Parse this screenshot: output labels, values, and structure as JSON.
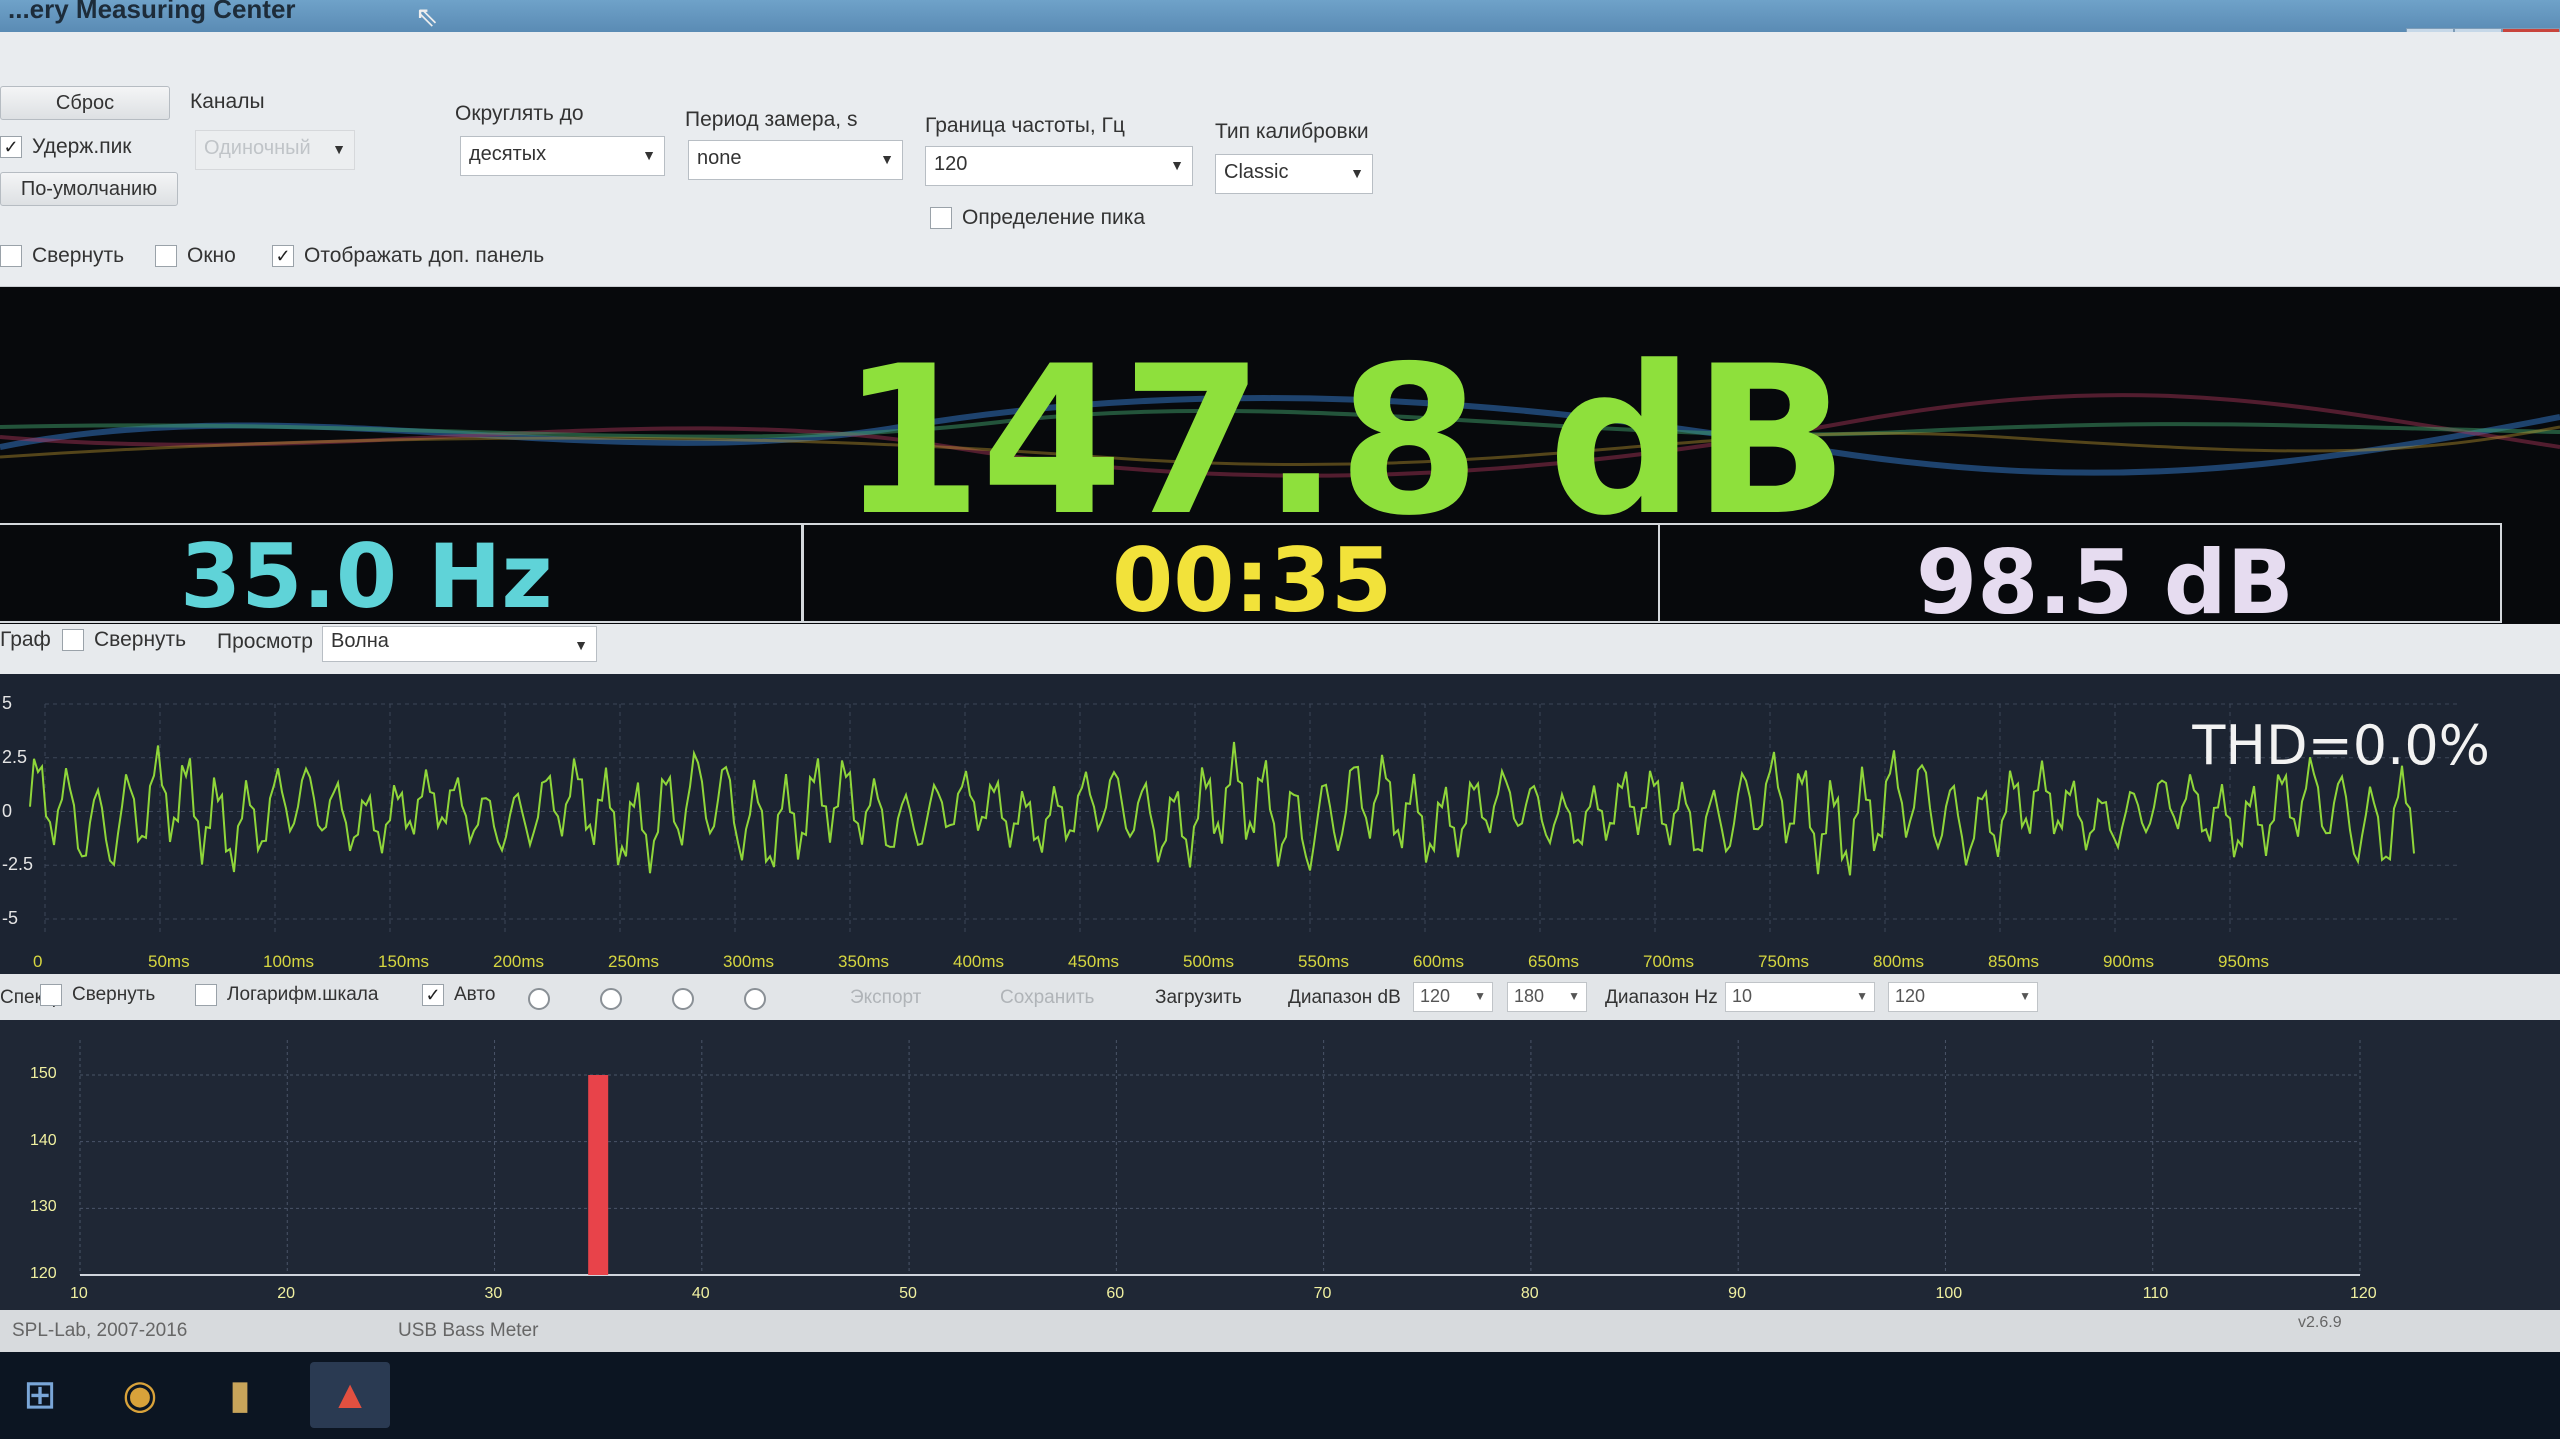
{
  "window": {
    "title": "...ery Measuring Center",
    "minimize": "—",
    "restore": "▫",
    "close": "X"
  },
  "toolbar": {
    "reset_label": "Сброс",
    "channels_label": "Каналы",
    "hold_peak_label": "Удерж.пик",
    "channel_mode_value": "Одиночный",
    "default_label": "По-умолчанию",
    "round_label": "Округлять до",
    "round_value": "десятых",
    "period_label": "Период замера, s",
    "period_value": "none",
    "freq_limit_label": "Граница частоты, Гц",
    "freq_limit_value": "120",
    "calib_label": "Тип калибровки",
    "calib_value": "Classic",
    "peak_detect_label": "Определение пика",
    "collapse_label": "Свернуть",
    "window_label": "Окно",
    "show_panel_label": "Отображать доп. панель",
    "show_panel_checked": "✓"
  },
  "meter": {
    "main_value": "147.8 dB",
    "frequency": "35.0 Hz",
    "timer": "00:35",
    "secondary_db": "98.5 dB",
    "colors": {
      "main": "#8ee03c",
      "frequency": "#5fd3d8",
      "timer": "#f2e23a",
      "secondary": "#e6dcf0"
    }
  },
  "wave_panel": {
    "graph_label": "Граф",
    "collapse_label": "Свернуть",
    "view_label": "Просмотр",
    "view_value": "Волна",
    "thd": "THD=0.0%",
    "y_ticks": [
      "5",
      "2.5",
      "0",
      "-2.5",
      "-5"
    ],
    "x_ticks": [
      "0",
      "50ms",
      "100ms",
      "150ms",
      "200ms",
      "250ms",
      "300ms",
      "350ms",
      "400ms",
      "450ms",
      "500ms",
      "550ms",
      "600ms",
      "650ms",
      "700ms",
      "750ms",
      "800ms",
      "850ms",
      "900ms",
      "950ms"
    ]
  },
  "spectrum_panel": {
    "label": "Спектр",
    "collapse_label": "Свернуть",
    "log_scale_label": "Логарифм.шкала",
    "auto_label": "Авто",
    "auto_checked": "✓",
    "export_label": "Экспорт",
    "save_label": "Сохранить",
    "load_label": "Загрузить",
    "db_range_label": "Диапазон dB",
    "db_min": "120",
    "db_max": "180",
    "hz_range_label": "Диапазон Hz",
    "hz_min": "10",
    "hz_max": "120",
    "y_ticks": [
      "150",
      "140",
      "130",
      "120"
    ],
    "x_ticks": [
      "10",
      "20",
      "30",
      "40",
      "50",
      "60",
      "70",
      "80",
      "90",
      "100",
      "110",
      "120"
    ]
  },
  "chart_data": {
    "type": "bar",
    "x": [
      35
    ],
    "values": [
      150
    ],
    "xlim": [
      10,
      120
    ],
    "ylim": [
      120,
      150
    ],
    "bar_color": "#e8434a"
  },
  "status": {
    "copyright": "SPL-Lab, 2007-2016",
    "device": "USB Bass Meter",
    "version": "v2.6.9"
  }
}
